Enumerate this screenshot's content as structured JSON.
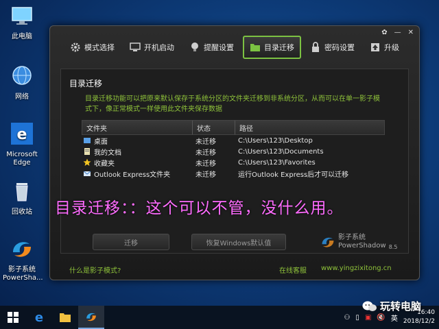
{
  "desktop": {
    "icons": [
      {
        "label": "此电脑"
      },
      {
        "label": "网络"
      },
      {
        "label": "Microsoft Edge"
      },
      {
        "label": "回收站"
      },
      {
        "label": "影子系统 PowerSha..."
      }
    ]
  },
  "window": {
    "tabs": [
      {
        "label": "模式选择"
      },
      {
        "label": "开机启动"
      },
      {
        "label": "提醒设置"
      },
      {
        "label": "目录迁移"
      },
      {
        "label": "密码设置"
      },
      {
        "label": "升级"
      }
    ],
    "active_tab": 3,
    "panel_title": "目录迁移",
    "description": "目录迁移功能可以把原来默认保存于系统分区的文件夹迁移到非系统分区，从而可以在单一影子模式下，像正常模式一样使用此文件夹保存数据",
    "table": {
      "headers": [
        "文件夹",
        "状态",
        "路径"
      ],
      "rows": [
        {
          "folder": "桌面",
          "status": "未迁移",
          "path": "C:\\Users\\123\\Desktop"
        },
        {
          "folder": "我的文档",
          "status": "未迁移",
          "path": "C:\\Users\\123\\Documents"
        },
        {
          "folder": "收藏夹",
          "status": "未迁移",
          "path": "C:\\Users\\123\\Favorites"
        },
        {
          "folder": "Outlook Express文件夹",
          "status": "未迁移",
          "path": "运行Outlook Express后才可以迁移"
        }
      ]
    },
    "buttons": {
      "migrate": "迁移",
      "restore": "恢复Windows默认值"
    },
    "brand": {
      "name": "影子系统",
      "name_en": "PowerShadow",
      "version": "8.5"
    },
    "footer": {
      "what_is": "什么是影子模式?",
      "online_service": "在线客服",
      "website": "www.yingzixitong.cn"
    }
  },
  "caption": "目录迁移：：这个可以不管，没什么用。",
  "taskbar": {
    "ime": "英",
    "time": "16:40",
    "date": "2018/12/2"
  },
  "watermark": "玩转电脑",
  "colors": {
    "accent_green": "#7cc242",
    "text_green": "#8fc33a",
    "caption_pink": "#ff6cff"
  }
}
